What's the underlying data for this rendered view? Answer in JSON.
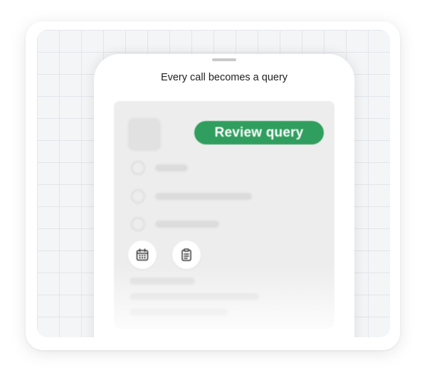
{
  "phone": {
    "title": "Every call becomes a query"
  },
  "panel": {
    "review_button_label": "Review query",
    "accent_color": "#2f9e5e",
    "action_icons": [
      "calendar-icon",
      "clipboard-icon"
    ]
  }
}
